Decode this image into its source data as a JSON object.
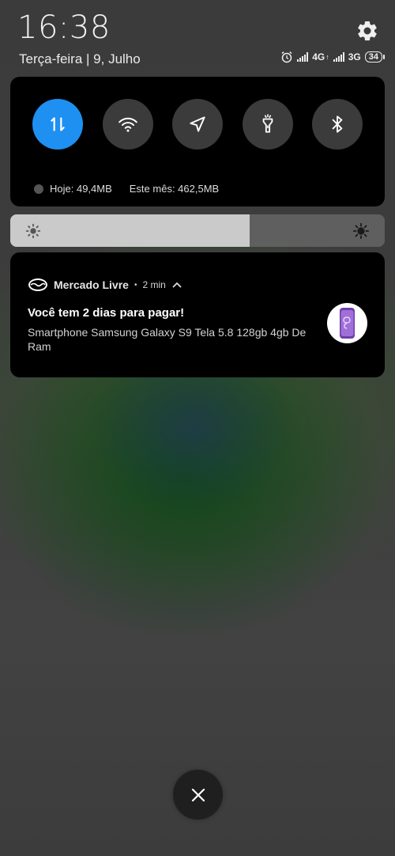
{
  "status": {
    "time": "16:38",
    "date": "Terça-feira | 9, Julho",
    "network_1": "4G",
    "network_2": "3G",
    "battery": "34"
  },
  "quick_settings": {
    "toggles": [
      {
        "name": "mobile-data",
        "icon": "data-arrows-icon",
        "active": true
      },
      {
        "name": "wifi",
        "icon": "wifi-icon",
        "active": false
      },
      {
        "name": "location",
        "icon": "location-icon",
        "active": false
      },
      {
        "name": "flashlight",
        "icon": "flashlight-icon",
        "active": false
      },
      {
        "name": "bluetooth",
        "icon": "bluetooth-icon",
        "active": false
      }
    ],
    "usage_today": "Hoje: 49,4MB",
    "usage_month": "Este mês: 462,5MB",
    "active_color": "#1e90f2"
  },
  "brightness": {
    "level": 0.64
  },
  "notification": {
    "app_name": "Mercado Livre",
    "separator": "•",
    "time_ago": "2 min",
    "title": "Você tem 2 dias para pagar!",
    "body": "Smartphone Samsung Galaxy S9 Tela 5.8  128gb 4gb De Ram"
  }
}
